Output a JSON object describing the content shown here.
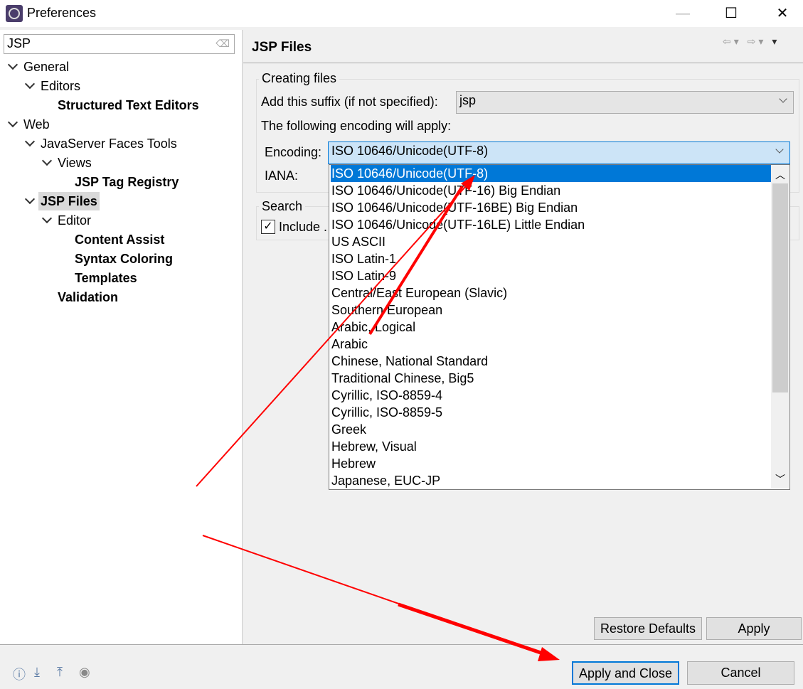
{
  "window": {
    "title": "Preferences",
    "minimize": "—",
    "maximize": "☐",
    "close": "✕"
  },
  "filter": {
    "value": "JSP"
  },
  "tree": [
    {
      "label": "General",
      "expanded": true
    },
    {
      "label": "Editors",
      "expanded": true
    },
    {
      "label": "Structured Text Editors"
    },
    {
      "label": "Web",
      "expanded": true
    },
    {
      "label": "JavaServer Faces Tools",
      "expanded": true
    },
    {
      "label": "Views",
      "expanded": true
    },
    {
      "label": "JSP Tag Registry"
    },
    {
      "label": "JSP Files",
      "expanded": true,
      "selected": true
    },
    {
      "label": "Editor",
      "expanded": true
    },
    {
      "label": "Content Assist"
    },
    {
      "label": "Syntax Coloring"
    },
    {
      "label": "Templates"
    },
    {
      "label": "Validation"
    }
  ],
  "page": {
    "title": "JSP Files",
    "creating": {
      "label": "Creating files",
      "suffix_label": "Add this suffix (if not specified):",
      "suffix_value": "jsp",
      "encoding_note": "The following encoding will apply:",
      "encoding_label": "Encoding:",
      "encoding_value": "ISO 10646/Unicode(UTF-8)",
      "iana_label": "IANA:"
    },
    "search": {
      "label": "Search",
      "include_label": "Include ...",
      "include_checked": true
    }
  },
  "encoding_options": [
    "ISO 10646/Unicode(UTF-8)",
    "ISO 10646/Unicode(UTF-16) Big Endian",
    "ISO 10646/Unicode(UTF-16BE) Big Endian",
    "ISO 10646/Unicode(UTF-16LE) Little Endian",
    "US ASCII",
    "ISO Latin-1",
    "ISO Latin-9",
    "Central/East European (Slavic)",
    "Southern European",
    "Arabic, Logical",
    "Arabic",
    "Chinese, National Standard",
    "Traditional Chinese, Big5",
    "Cyrillic, ISO-8859-4",
    "Cyrillic, ISO-8859-5",
    "Greek",
    "Hebrew, Visual",
    "Hebrew",
    "Japanese, EUC-JP"
  ],
  "buttons": {
    "restore": "Restore Defaults",
    "apply": "Apply",
    "apply_close": "Apply and Close",
    "cancel": "Cancel"
  },
  "colors": {
    "selection": "#0078d7",
    "annotation_arrow": "#ff0000"
  }
}
